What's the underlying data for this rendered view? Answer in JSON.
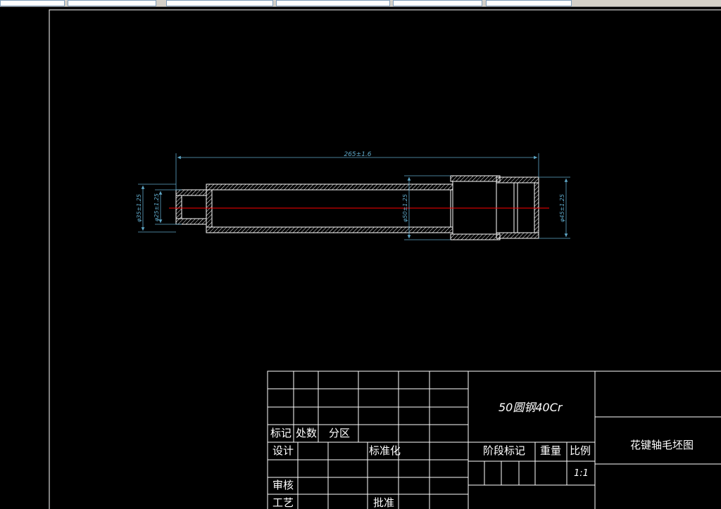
{
  "toolbar": {
    "fields": [
      "",
      "",
      "",
      "",
      "",
      "",
      ""
    ]
  },
  "drawing": {
    "dimensions": {
      "overall_length": "265±1.6",
      "dia_25": "φ25±1.25",
      "dia_35": "φ35±1.25",
      "dia_50": "φ50±1.25",
      "dia_45": "φ45±1.25"
    }
  },
  "title_block": {
    "material": "50圆钢40Cr",
    "drawing_title": "花键轴毛坯图",
    "mark_label": "标记",
    "count_label": "处数",
    "zone_label": "分区",
    "design_label": "设计",
    "standardize_label": "标准化",
    "stage_mark_label": "阶段标记",
    "weight_label": "重量",
    "scale_label": "比例",
    "scale_value": "1:1",
    "review_label": "审核",
    "process_label": "工艺",
    "approve_label": "批准"
  },
  "colors": {
    "background": "#000000",
    "frame": "#ffffff",
    "part_outline": "#ffffff",
    "centerline": "#ff0000",
    "dimension": "#5fa8c8"
  }
}
